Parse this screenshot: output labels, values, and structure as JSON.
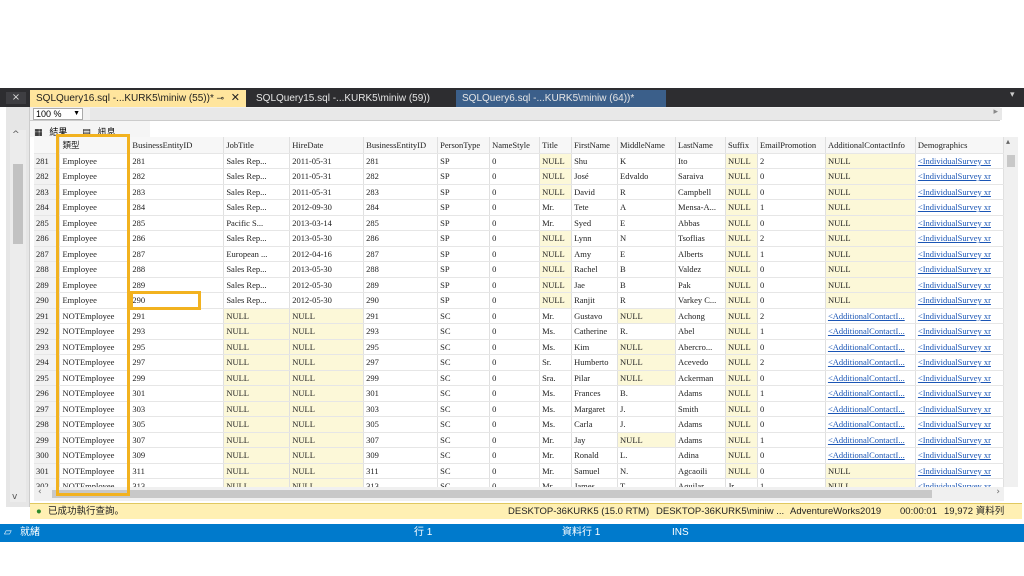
{
  "tabs": [
    {
      "label": "SQLQuery16.sql -...KURK5\\miniw (55))*",
      "active": true
    },
    {
      "label": "SQLQuery15.sql -...KURK5\\miniw (59))",
      "active": false
    },
    {
      "label": "SQLQuery6.sql -...KURK5\\miniw (64))*",
      "active": false
    }
  ],
  "editor_icon": "×",
  "zoom": "100 %",
  "result_tabs": [
    "結果",
    "訊息"
  ],
  "columns": [
    "",
    "類型",
    "BusinessEntityID",
    "JobTitle",
    "HireDate",
    "BusinessEntityID",
    "PersonType",
    "NameStyle",
    "Title",
    "FirstName",
    "MiddleName",
    "LastName",
    "Suffix",
    "EmailPromotion",
    "AdditionalContactInfo",
    "Demographics"
  ],
  "rows": [
    [
      "281",
      "Employee",
      "281",
      "Sales Rep...",
      "2011-05-31",
      "281",
      "SP",
      "0",
      "NULL",
      "Shu",
      "K",
      "Ito",
      "NULL",
      "2",
      "NULL",
      "<IndividualSurvey xr"
    ],
    [
      "282",
      "Employee",
      "282",
      "Sales Rep...",
      "2011-05-31",
      "282",
      "SP",
      "0",
      "NULL",
      "José",
      "Edvaldo",
      "Saraiva",
      "NULL",
      "0",
      "NULL",
      "<IndividualSurvey xr"
    ],
    [
      "283",
      "Employee",
      "283",
      "Sales Rep...",
      "2011-05-31",
      "283",
      "SP",
      "0",
      "NULL",
      "David",
      "R",
      "Campbell",
      "NULL",
      "0",
      "NULL",
      "<IndividualSurvey xr"
    ],
    [
      "284",
      "Employee",
      "284",
      "Sales Rep...",
      "2012-09-30",
      "284",
      "SP",
      "0",
      "Mr.",
      "Tete",
      "A",
      "Mensa-A...",
      "NULL",
      "1",
      "NULL",
      "<IndividualSurvey xr"
    ],
    [
      "285",
      "Employee",
      "285",
      "Pacific S...",
      "2013-03-14",
      "285",
      "SP",
      "0",
      "Mr.",
      "Syed",
      "E",
      "Abbas",
      "NULL",
      "0",
      "NULL",
      "<IndividualSurvey xr"
    ],
    [
      "286",
      "Employee",
      "286",
      "Sales Rep...",
      "2013-05-30",
      "286",
      "SP",
      "0",
      "NULL",
      "Lynn",
      "N",
      "Tsoflias",
      "NULL",
      "2",
      "NULL",
      "<IndividualSurvey xr"
    ],
    [
      "287",
      "Employee",
      "287",
      "European ...",
      "2012-04-16",
      "287",
      "SP",
      "0",
      "NULL",
      "Amy",
      "E",
      "Alberts",
      "NULL",
      "1",
      "NULL",
      "<IndividualSurvey xr"
    ],
    [
      "288",
      "Employee",
      "288",
      "Sales Rep...",
      "2013-05-30",
      "288",
      "SP",
      "0",
      "NULL",
      "Rachel",
      "B",
      "Valdez",
      "NULL",
      "0",
      "NULL",
      "<IndividualSurvey xr"
    ],
    [
      "289",
      "Employee",
      "289",
      "Sales Rep...",
      "2012-05-30",
      "289",
      "SP",
      "0",
      "NULL",
      "Jae",
      "B",
      "Pak",
      "NULL",
      "0",
      "NULL",
      "<IndividualSurvey xr"
    ],
    [
      "290",
      "Employee",
      "290",
      "Sales Rep...",
      "2012-05-30",
      "290",
      "SP",
      "0",
      "NULL",
      "Ranjit",
      "R",
      "Varkey C...",
      "NULL",
      "0",
      "NULL",
      "<IndividualSurvey xr"
    ],
    [
      "291",
      "NOTEmployee",
      "291",
      "NULL",
      "NULL",
      "291",
      "SC",
      "0",
      "Mr.",
      "Gustavo",
      "NULL",
      "Achong",
      "NULL",
      "2",
      "<AdditionalContactI...",
      "<IndividualSurvey xr"
    ],
    [
      "292",
      "NOTEmployee",
      "293",
      "NULL",
      "NULL",
      "293",
      "SC",
      "0",
      "Ms.",
      "Catherine",
      "R.",
      "Abel",
      "NULL",
      "1",
      "<AdditionalContactI...",
      "<IndividualSurvey xr"
    ],
    [
      "293",
      "NOTEmployee",
      "295",
      "NULL",
      "NULL",
      "295",
      "SC",
      "0",
      "Ms.",
      "Kim",
      "NULL",
      "Abercro...",
      "NULL",
      "0",
      "<AdditionalContactI...",
      "<IndividualSurvey xr"
    ],
    [
      "294",
      "NOTEmployee",
      "297",
      "NULL",
      "NULL",
      "297",
      "SC",
      "0",
      "Sr.",
      "Humberto",
      "NULL",
      "Acevedo",
      "NULL",
      "2",
      "<AdditionalContactI...",
      "<IndividualSurvey xr"
    ],
    [
      "295",
      "NOTEmployee",
      "299",
      "NULL",
      "NULL",
      "299",
      "SC",
      "0",
      "Sra.",
      "Pilar",
      "NULL",
      "Ackerman",
      "NULL",
      "0",
      "<AdditionalContactI...",
      "<IndividualSurvey xr"
    ],
    [
      "296",
      "NOTEmployee",
      "301",
      "NULL",
      "NULL",
      "301",
      "SC",
      "0",
      "Ms.",
      "Frances",
      "B.",
      "Adams",
      "NULL",
      "1",
      "<AdditionalContactI...",
      "<IndividualSurvey xr"
    ],
    [
      "297",
      "NOTEmployee",
      "303",
      "NULL",
      "NULL",
      "303",
      "SC",
      "0",
      "Ms.",
      "Margaret",
      "J.",
      "Smith",
      "NULL",
      "0",
      "<AdditionalContactI...",
      "<IndividualSurvey xr"
    ],
    [
      "298",
      "NOTEmployee",
      "305",
      "NULL",
      "NULL",
      "305",
      "SC",
      "0",
      "Ms.",
      "Carla",
      "J.",
      "Adams",
      "NULL",
      "0",
      "<AdditionalContactI...",
      "<IndividualSurvey xr"
    ],
    [
      "299",
      "NOTEmployee",
      "307",
      "NULL",
      "NULL",
      "307",
      "SC",
      "0",
      "Mr.",
      "Jay",
      "NULL",
      "Adams",
      "NULL",
      "1",
      "<AdditionalContactI...",
      "<IndividualSurvey xr"
    ],
    [
      "300",
      "NOTEmployee",
      "309",
      "NULL",
      "NULL",
      "309",
      "SC",
      "0",
      "Mr.",
      "Ronald",
      "L.",
      "Adina",
      "NULL",
      "0",
      "<AdditionalContactI...",
      "<IndividualSurvey xr"
    ],
    [
      "301",
      "NOTEmployee",
      "311",
      "NULL",
      "NULL",
      "311",
      "SC",
      "0",
      "Mr.",
      "Samuel",
      "N.",
      "Agcaoili",
      "NULL",
      "0",
      "NULL",
      "<IndividualSurvey xr"
    ],
    [
      "302",
      "NOTEmployee",
      "313",
      "NULL",
      "NULL",
      "313",
      "SC",
      "0",
      "Mr.",
      "James",
      "T.",
      "Aguilar",
      "Jr.",
      "1",
      "NULL",
      "<IndividualSurvey xr"
    ]
  ],
  "query_status": {
    "message": "已成功執行查詢。",
    "server": "DESKTOP-36KURK5 (15.0 RTM)",
    "user": "DESKTOP-36KURK5\\miniw ...",
    "database": "AdventureWorks2019",
    "elapsed": "00:00:01",
    "row_count": "19,972 資料列"
  },
  "app_status": {
    "ready": "就緒",
    "line": "行 1",
    "column": "資料行 1",
    "mode": "INS"
  },
  "colors": {
    "accent_highlight": "#f2b21f",
    "status_blue": "#007acc",
    "active_tab": "#ffe59d",
    "null_cell": "#fcf8d8"
  }
}
